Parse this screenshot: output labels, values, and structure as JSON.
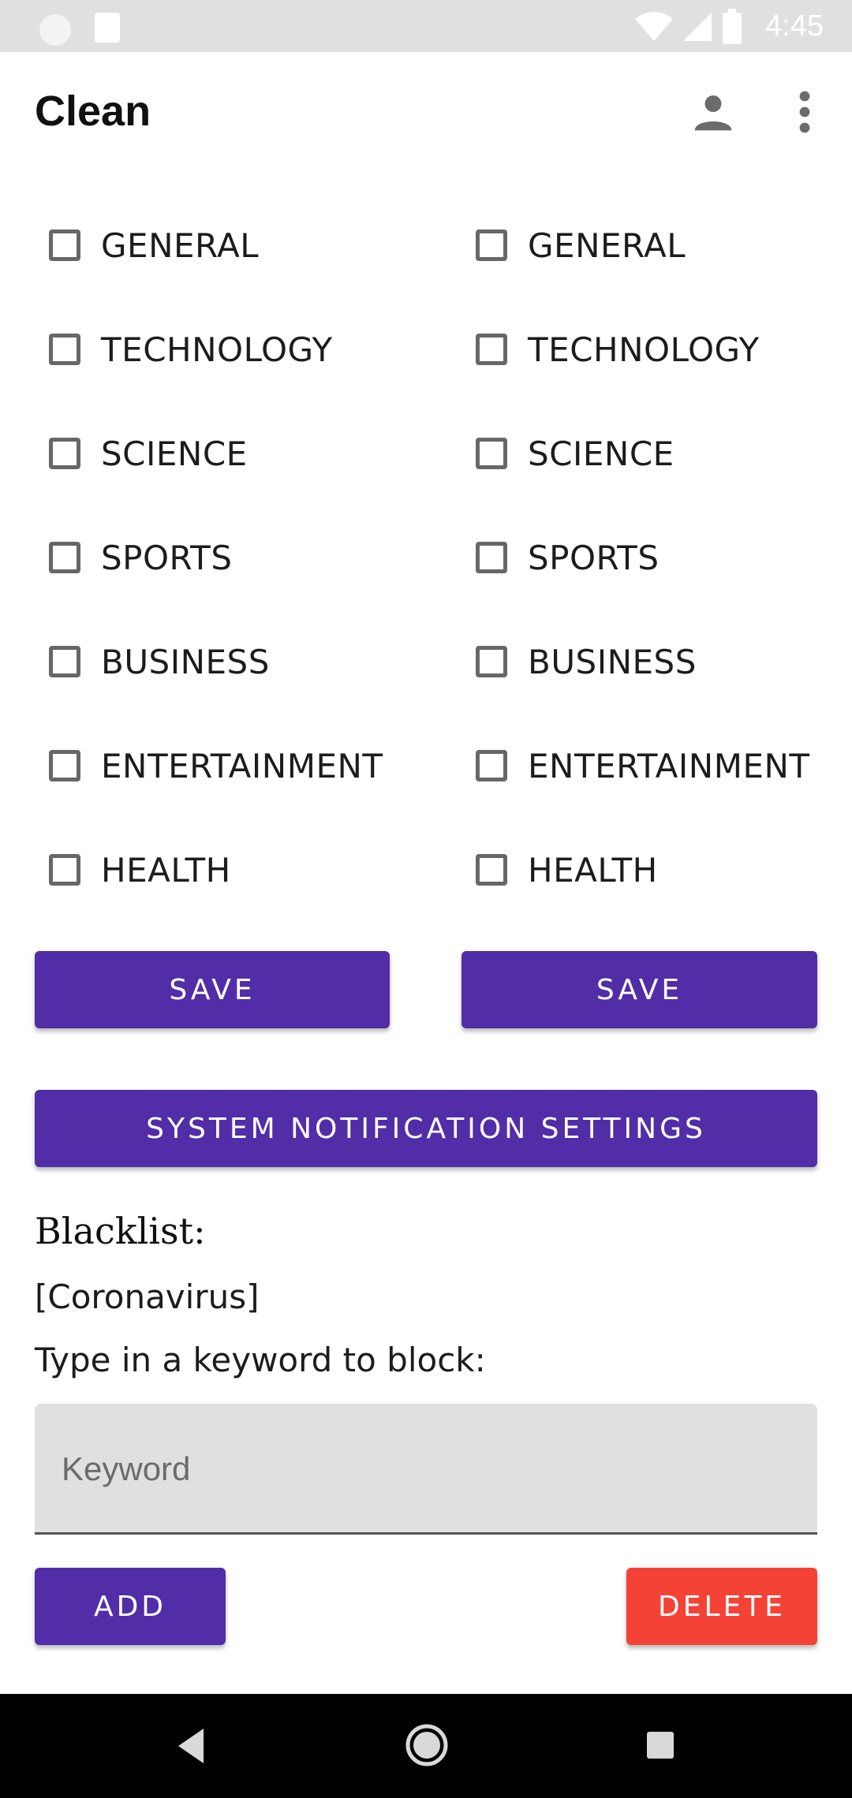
{
  "status_bar": {
    "time": "4:45"
  },
  "app_bar": {
    "title": "Clean",
    "icons": [
      "account-icon",
      "more-vert-icon"
    ]
  },
  "categories": {
    "left": [
      {
        "label": "GENERAL",
        "checked": false
      },
      {
        "label": "TECHNOLOGY",
        "checked": false
      },
      {
        "label": "SCIENCE",
        "checked": false
      },
      {
        "label": "SPORTS",
        "checked": false
      },
      {
        "label": "BUSINESS",
        "checked": false
      },
      {
        "label": "ENTERTAINMENT",
        "checked": false
      },
      {
        "label": "HEALTH",
        "checked": false
      }
    ],
    "right": [
      {
        "label": "GENERAL",
        "checked": false
      },
      {
        "label": "TECHNOLOGY",
        "checked": false
      },
      {
        "label": "SCIENCE",
        "checked": false
      },
      {
        "label": "SPORTS",
        "checked": false
      },
      {
        "label": "BUSINESS",
        "checked": false
      },
      {
        "label": "ENTERTAINMENT",
        "checked": false
      },
      {
        "label": "HEALTH",
        "checked": false
      }
    ]
  },
  "buttons": {
    "save_left": "SAVE",
    "save_right": "SAVE",
    "system_notification_settings": "SYSTEM NOTIFICATION SETTINGS",
    "add": "ADD",
    "delete": "DELETE"
  },
  "blacklist": {
    "title": "Blacklist:",
    "value": "[Coronavirus]",
    "prompt": "Type in a keyword to block:",
    "input_placeholder": "Keyword",
    "input_value": ""
  },
  "colors": {
    "primary": "#512da8",
    "danger": "#f44336",
    "status_bar": "#e0e0e0",
    "nav_bar": "#000000"
  }
}
